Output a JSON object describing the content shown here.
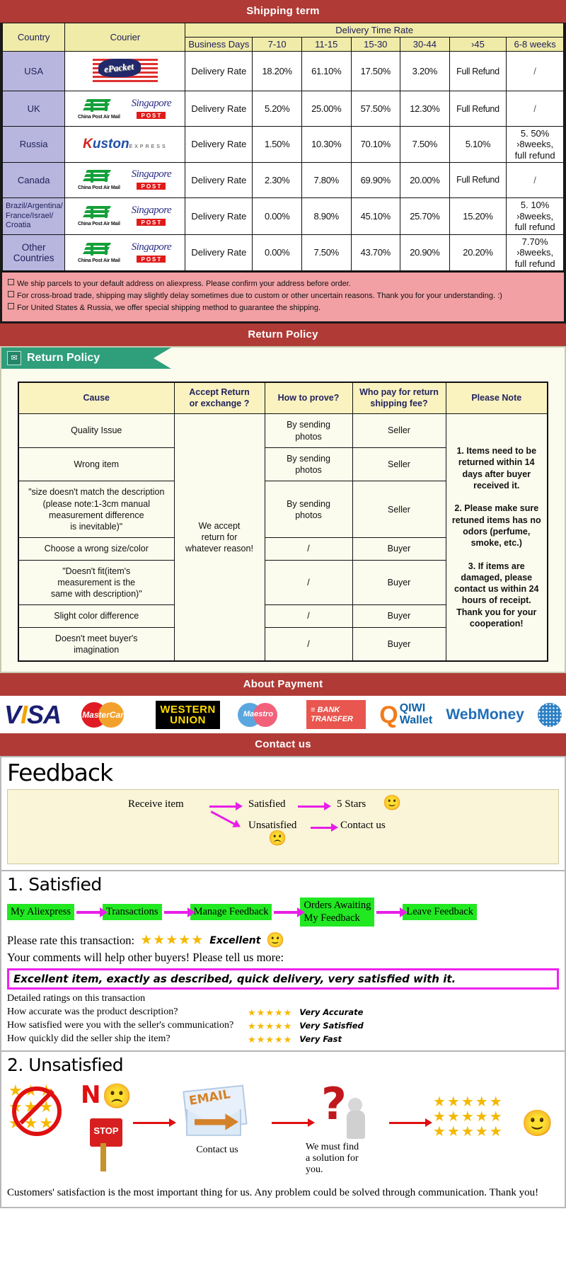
{
  "banners": {
    "shipping": "Shipping term",
    "return": "Return Policy",
    "payment": "About Payment",
    "contact": "Contact us"
  },
  "shipping": {
    "headers": {
      "country": "Country",
      "courier": "Courier",
      "delivery_time_rate": "Delivery Time Rate",
      "business_days": "Business Days",
      "ranges": [
        "7-10",
        "11-15",
        "15-30",
        "30-44",
        "›45",
        "6-8 weeks"
      ]
    },
    "rate_label": "Delivery Rate",
    "rows": [
      {
        "country": "USA",
        "couriers": [
          "epacket-logo"
        ],
        "values": [
          "18.20%",
          "61.10%",
          "17.50%",
          "3.20%",
          "Full Refund",
          "/"
        ]
      },
      {
        "country": "UK",
        "couriers": [
          "china-post-air-mail-logo",
          "singapore-post-logo"
        ],
        "values": [
          "5.20%",
          "25.00%",
          "57.50%",
          "12.30%",
          "Full Refund",
          "/"
        ]
      },
      {
        "country": "Russia",
        "couriers": [
          "kuston-express-logo"
        ],
        "values": [
          "1.50%",
          "10.30%",
          "70.10%",
          "7.50%",
          "5.10%",
          "5. 50%\n›8weeks,\nfull refund"
        ]
      },
      {
        "country": "Canada",
        "couriers": [
          "china-post-air-mail-logo",
          "singapore-post-logo"
        ],
        "values": [
          "2.30%",
          "7.80%",
          "69.90%",
          "20.00%",
          "Full Refund",
          "/"
        ]
      },
      {
        "country": "Brazil/Argentina/\nFrance/Israel/\nCroatia",
        "couriers": [
          "china-post-air-mail-logo",
          "singapore-post-logo"
        ],
        "values": [
          "0.00%",
          "8.90%",
          "45.10%",
          "25.70%",
          "15.20%",
          "5. 10%\n›8weeks,\nfull refund"
        ]
      },
      {
        "country": "Other Countries",
        "couriers": [
          "china-post-air-mail-logo",
          "singapore-post-logo"
        ],
        "values": [
          "0.00%",
          "7.50%",
          "43.70%",
          "20.90%",
          "20.20%",
          "7.70%\n›8weeks,\nfull refund"
        ]
      }
    ],
    "notes": [
      "We ship parcels to your default address on aliexpress. Please confirm your address before order.",
      "For cross-broad trade, shipping may slightly delay sometimes due to custom or other uncertain reasons. Thank you for your understanding. :)",
      "For United States & Russia, we offer special shipping method to guarantee the shipping."
    ]
  },
  "return_policy": {
    "tab_label": "Return Policy",
    "headers": [
      "Cause",
      "Accept Return\nor exchange ?",
      "How to prove?",
      "Who pay for return\nshipping fee?",
      "Please Note"
    ],
    "accept_cell": "We accept\nreturn for\nwhatever reason!",
    "rows": [
      {
        "cause": "Quality Issue",
        "prove": "By sending\nphotos",
        "who": "Seller"
      },
      {
        "cause": "Wrong item",
        "prove": "By sending\nphotos",
        "who": "Seller"
      },
      {
        "cause": "\"size doesn't match the description\n(please note:1-3cm manual\nmeasurement difference\nis inevitable)\"",
        "prove": "By sending\nphotos",
        "who": "Seller"
      },
      {
        "cause": "Choose a wrong size/color",
        "prove": "/",
        "who": "Buyer"
      },
      {
        "cause": "\"Doesn't fit(item's\nmeasurement is the\nsame with description)\"",
        "prove": "/",
        "who": "Buyer"
      },
      {
        "cause": "Slight color difference",
        "prove": "/",
        "who": "Buyer"
      },
      {
        "cause": "Doesn't meet buyer's\nimagination",
        "prove": "/",
        "who": "Buyer"
      }
    ],
    "note": "1. Items need to be returned within 14 days after buyer received it.\n\n2. Please make sure retuned items has no odors (perfume, smoke, etc.)\n\n3. If items are damaged, please contact us within 24 hours of receipt.\nThank you for your cooperation!"
  },
  "payment": {
    "methods": [
      {
        "name": "visa-logo",
        "label": "VISA"
      },
      {
        "name": "mastercard-logo",
        "label": "MasterCard"
      },
      {
        "name": "western-union-logo",
        "label": "WESTERN\nUNION"
      },
      {
        "name": "maestro-logo",
        "label": "Maestro"
      },
      {
        "name": "bank-transfer-logo",
        "label": "BANK\nTRANSFER"
      },
      {
        "name": "qiwi-wallet-logo",
        "label": "QIWI\nWallet"
      },
      {
        "name": "webmoney-logo",
        "label": "WebMoney"
      }
    ]
  },
  "feedback": {
    "title": "Feedback",
    "flow": {
      "receive_item": "Receive item",
      "satisfied": "Satisfied",
      "five_stars": "5 Stars",
      "unsatisfied": "Unsatisfied",
      "contact_us": "Contact us",
      "happy_emoji": "🙂",
      "sad_emoji": "☹"
    },
    "satisfied": {
      "heading": "1. Satisfied",
      "steps": [
        "My Aliexpress",
        "Transactions",
        "Manage Feedback",
        "Orders Awaiting\nMy Feedback",
        "Leave Feedback"
      ],
      "rate_label": "Please rate this transaction:",
      "rate_stars": "★★★★★",
      "rate_word": "Excellent",
      "comments_prompt": "Your comments will help other buyers! Please tell us more:",
      "comment_text": "Excellent item, exactly as described, quick delivery, very satisfied with it.",
      "detailed_heading": "Detailed ratings on this transaction",
      "detailed": [
        {
          "question": "How accurate was the product description?",
          "stars": "★★★★★",
          "value": "Very Accurate"
        },
        {
          "question": "How satisfied were you with the seller's communication?",
          "stars": "★★★★★",
          "value": "Very Satisfied"
        },
        {
          "question": "How quickly did the seller ship the item?",
          "stars": "★★★★★",
          "value": "Very Fast"
        }
      ]
    },
    "unsatisfied": {
      "heading": "2. Unsatisfied",
      "no_label": "N",
      "stop_label": "STOP",
      "email_label": "EMAIL",
      "contact_us": "Contact us",
      "solution_text": "We must find\na solution for\nyou.",
      "stars_block": "★★★★★",
      "footer": "Customers' satisfaction is the most important thing for us. Any problem could be solved through communication. Thank you!"
    }
  }
}
